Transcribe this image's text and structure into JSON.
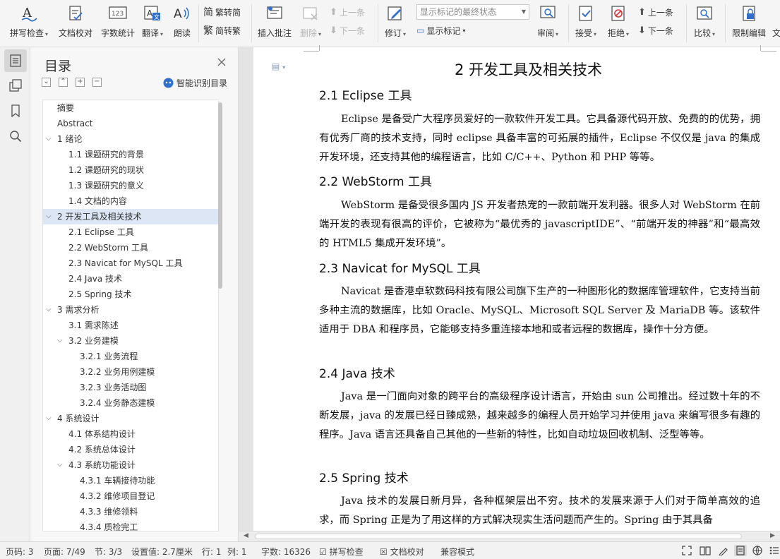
{
  "ribbon": {
    "spellcheck": "拼写检查",
    "doc_proofread": "文档校对",
    "word_count": "字数统计",
    "translate": "翻译",
    "read_aloud": "朗读",
    "simp_to_trad": "繁转简",
    "trad_to_simp": "简转繁",
    "insert_comment": "插入批注",
    "delete": "删除",
    "prev_comment": "上一条",
    "next_comment": "下一条",
    "revise": "修订",
    "markup_state": "显示标记的最终状态",
    "show_markup": "显示标记",
    "review": "审阅",
    "accept": "接受",
    "reject": "拒绝",
    "prev_change": "上一条",
    "next_change": "下一条",
    "compare": "比较",
    "restrict_edit": "限制编辑",
    "more": "文"
  },
  "toc": {
    "title": "目录",
    "smart_toc": "智能识别目录",
    "items": [
      {
        "label": "摘要"
      },
      {
        "label": "Abstract"
      },
      {
        "label": "1  绪论"
      },
      {
        "label": "1.1  课题研究的背景"
      },
      {
        "label": "1.2  课题研究的现状"
      },
      {
        "label": "1.3  课题研究的意义"
      },
      {
        "label": "1.4  文档的内容"
      },
      {
        "label": "2  开发工具及相关技术"
      },
      {
        "label": "2.1 Eclipse 工具"
      },
      {
        "label": "2.2 WebStorm 工具"
      },
      {
        "label": "2.3 Navicat for MySQL 工具"
      },
      {
        "label": "2.4 Java 技术"
      },
      {
        "label": "2.5 Spring 技术"
      },
      {
        "label": "3  需求分析"
      },
      {
        "label": "3.1  需求陈述"
      },
      {
        "label": "3.2  业务建模"
      },
      {
        "label": "3.2.1  业务流程"
      },
      {
        "label": "3.2.2  业务用例建模"
      },
      {
        "label": "3.2.3  业务活动图"
      },
      {
        "label": "3.2.4  业务静态建模"
      },
      {
        "label": "4  系统设计"
      },
      {
        "label": "4.1  体系结构设计"
      },
      {
        "label": "4.2  系统总体设计"
      },
      {
        "label": "4.3  系统功能设计"
      },
      {
        "label": "4.3.1  车辆接待功能"
      },
      {
        "label": "4.3.2  维修项目登记"
      },
      {
        "label": "4.3.3  维修领料"
      },
      {
        "label": "4.3.4  质检完工"
      }
    ]
  },
  "document": {
    "chapter_title": "2  开发工具及相关技术",
    "sections": [
      {
        "heading": "2.1 Eclipse 工具",
        "body": "Eclipse 是备受广大程序员爱好的一款软件开发工具。它具备源代码开放、免费的的优势，拥有优秀厂商的技术支持，同时 eclipse 具备丰富的可拓展的插件，Eclipse 不仅仅是 java 的集成开发环境，还支持其他的编程语言，比如 C/C++、Python 和 PHP 等等。"
      },
      {
        "heading": "2.2 WebStorm 工具",
        "body": "WebStorm 是备受很多国内 JS 开发者热宠的一款前端开发利器。很多人对 WebStorm 在前端开发的表现有很高的评价，它被称为“最优秀的 javascriptIDE”、“前端开发的神器”和“最高效的 HTML5 集成开发环境”。"
      },
      {
        "heading": "2.3 Navicat for MySQL 工具",
        "body": "Navicat 是香港卓软数码科技有限公司旗下生产的一种图形化的数据库管理软件，它支持当前多种主流的数据库，比如 Oracle、MySQL、Microsoft SQL Server 及 MariaDB 等。该软件适用于 DBA 和程序员，它能够支持多重连接本地和或者远程的数据库，操作十分方便。"
      },
      {
        "heading": "2.4 Java 技术",
        "body": "Java 是一门面向对象的跨平台的高级程序设计语言，开始由 sun 公司推出。经过数十年的不断发展，java 的发展已经日臻成熟，越来越多的编程人员开始学习并使用 java 来编写很多有趣的程序。Java 语言还具备自己其他的一些新的特性，比如自动垃圾回收机制、泛型等等。"
      },
      {
        "heading": "2.5 Spring 技术",
        "body": "Java 技术的发展日新月异，各种框架层出不穷。技术的发展来源于人们对于简单高效的追求，而 Spring 正是为了用这样的方式解决现实生活问题而产生的。Spring 由于其具备"
      }
    ]
  },
  "status": {
    "page_no": "页码: 3",
    "page": "页面: 7/49",
    "section": "节: 3/3",
    "setting": "设置值: 2.7厘米",
    "row": "行: 1",
    "col": "列: 1",
    "word_count": "字数: 16326",
    "spellcheck": "拼写检查",
    "doc_proofread": "文档校对",
    "compat_mode": "兼容模式"
  },
  "colors": {
    "accent_blue": "#2f6fd0",
    "selection": "#dce6f5",
    "spell_underline": "#d9534f"
  }
}
